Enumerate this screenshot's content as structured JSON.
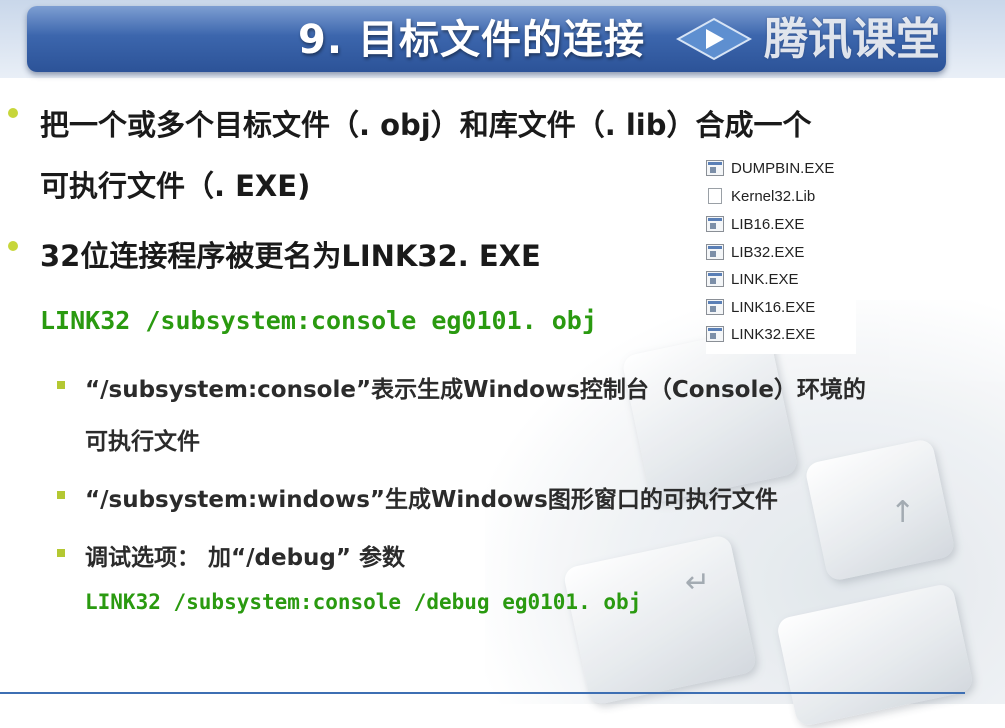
{
  "header": {
    "title": "9. 目标文件的连接",
    "logo_text": "腾讯课堂"
  },
  "bullets": [
    {
      "line1": "把一个或多个目标文件（. obj）和库文件（. lib）合成一个",
      "line2": "可执行文件（. EXE)"
    },
    {
      "line1": "32位连接程序被更名为LINK32. EXE",
      "code": "LINK32 /subsystem:console eg0101. obj"
    }
  ],
  "sub_bullets": [
    {
      "line1": "“/subsystem:console”表示生成Windows控制台（Console）环境的",
      "line2": "可执行文件"
    },
    {
      "line1": "“/subsystem:windows”生成Windows图形窗口的可执行文件"
    },
    {
      "line1": "调试选项： 加“/debug” 参数",
      "code": "LINK32 /subsystem:console /debug eg0101. obj"
    }
  ],
  "files": [
    {
      "name": "DUMPBIN.EXE",
      "icon": "exe-icon"
    },
    {
      "name": "Kernel32.Lib",
      "icon": "document-icon"
    },
    {
      "name": "LIB16.EXE",
      "icon": "exe-icon"
    },
    {
      "name": "LIB32.EXE",
      "icon": "exe-icon"
    },
    {
      "name": "LINK.EXE",
      "icon": "exe-icon"
    },
    {
      "name": "LINK16.EXE",
      "icon": "exe-icon"
    },
    {
      "name": "LINK32.EXE",
      "icon": "exe-icon"
    }
  ],
  "colors": {
    "title_bar": "#3c66ad",
    "code_text": "#2a9a10",
    "bullet": "#c7d63a"
  }
}
